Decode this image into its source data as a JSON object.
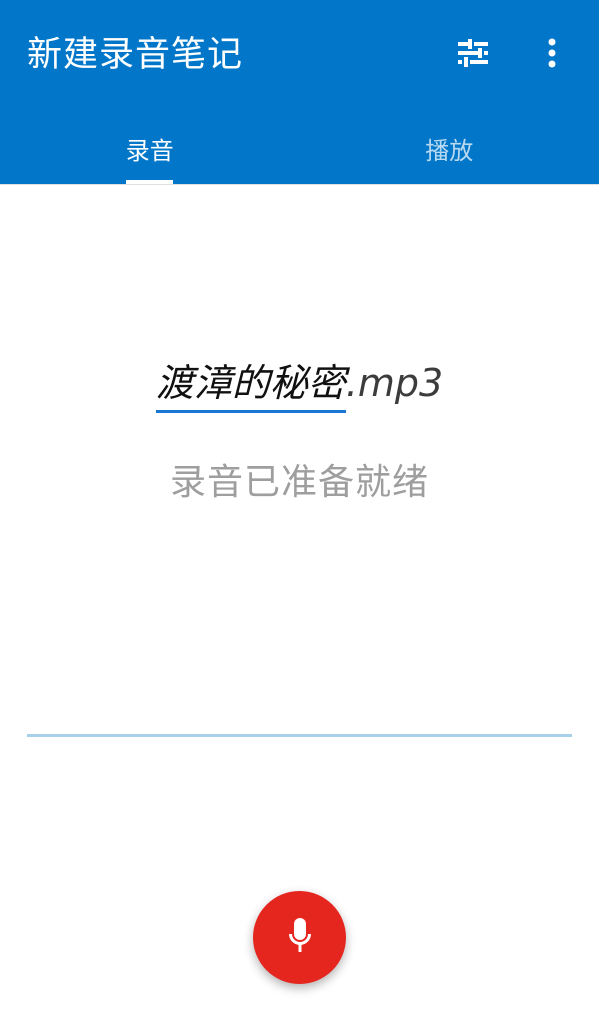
{
  "app_bar": {
    "title": "新建录音笔记",
    "actions": [
      {
        "icon": "tune-icon"
      },
      {
        "icon": "more-vert-icon"
      }
    ]
  },
  "tabs": [
    {
      "label": "录音",
      "active": true
    },
    {
      "label": "播放",
      "active": false
    }
  ],
  "recording": {
    "filename": "渡漳的秘密",
    "extension": ".mp3",
    "status": "录音已准备就绪"
  },
  "fab": {
    "icon": "microphone-icon"
  },
  "colors": {
    "primary": "#0277c9",
    "accent_underline": "#1976d2",
    "level_line": "#a7d1ea",
    "fab": "#e5261f",
    "status_text": "#9e9e9e"
  }
}
